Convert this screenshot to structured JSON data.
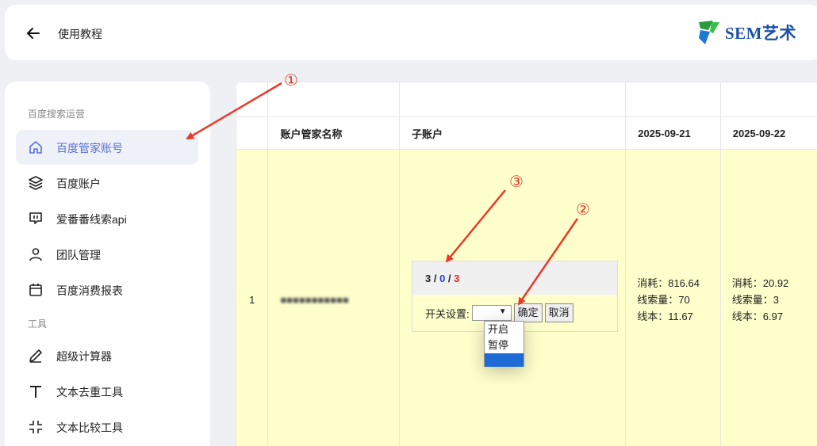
{
  "header": {
    "title": "使用教程",
    "logo_text": "SEM艺术"
  },
  "sidebar": {
    "groups": [
      "百度搜索运营",
      "工具"
    ],
    "items": [
      {
        "label": "百度管家账号",
        "icon": "home-icon"
      },
      {
        "label": "百度账户",
        "icon": "layers-icon"
      },
      {
        "label": "爱番番线索api",
        "icon": "chat-icon"
      },
      {
        "label": "团队管理",
        "icon": "user-icon"
      },
      {
        "label": "百度消费报表",
        "icon": "calendar-icon"
      },
      {
        "label": "超级计算器",
        "icon": "pen-icon"
      },
      {
        "label": "文本去重工具",
        "icon": "text-icon"
      },
      {
        "label": "文本比较工具",
        "icon": "compress-icon"
      }
    ]
  },
  "table": {
    "headers": [
      "",
      "账户管家名称",
      "子账户",
      "2025-09-21",
      "2025-09-22"
    ],
    "row": {
      "index": "1",
      "name": "■■■■■■■■■■■",
      "sub_counts": {
        "a": "3",
        "sep": " / ",
        "b": "0",
        "c": "3"
      },
      "switch_label": "开关设置:",
      "confirm": "确定",
      "cancel": "取消",
      "options": [
        "开启",
        "暂停"
      ],
      "day1": {
        "cost": "消耗：816.64",
        "leads": "线索量：70",
        "cpl": "线本：11.67"
      },
      "day2": {
        "cost": "消耗：20.92",
        "leads": "线索量：3",
        "cpl": "线本：6.97"
      }
    }
  },
  "annotations": [
    "①",
    "②",
    "③"
  ],
  "colors": {
    "accent": "#5a6fd6",
    "annotation": "#e83a2a",
    "row_highlight": "#ffffcc",
    "logo": "#1a4ea8"
  }
}
